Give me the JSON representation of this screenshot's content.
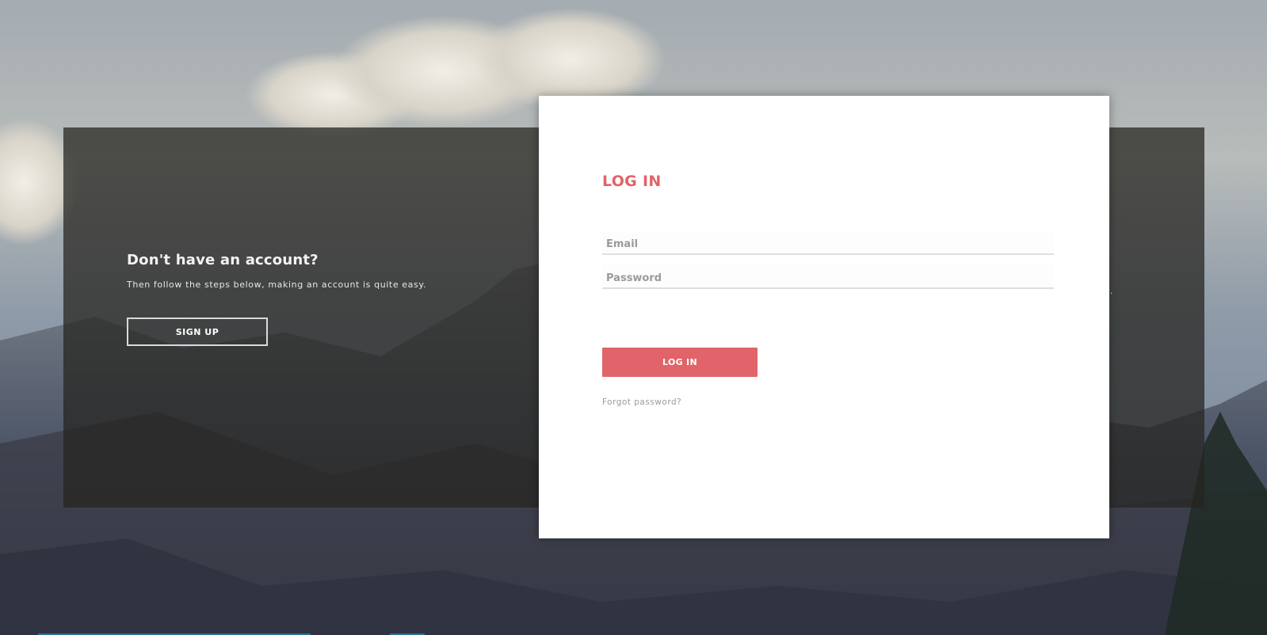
{
  "signup": {
    "title": "Don't have an account?",
    "text": "Then follow the steps below, making an account is quite easy.",
    "button_label": "SIGN UP"
  },
  "hidden_panel": {
    "visible_fragment": "ne."
  },
  "login": {
    "title": "LOG IN",
    "email_placeholder": "Email",
    "email_value": "",
    "password_placeholder": "Password",
    "password_value": "",
    "button_label": "LOG IN",
    "forgot_label": "Forgot password?"
  },
  "colors": {
    "accent": "#e06469",
    "panel_overlay": "rgba(38,36,33,0.74)",
    "card_bg": "#ffffff"
  }
}
